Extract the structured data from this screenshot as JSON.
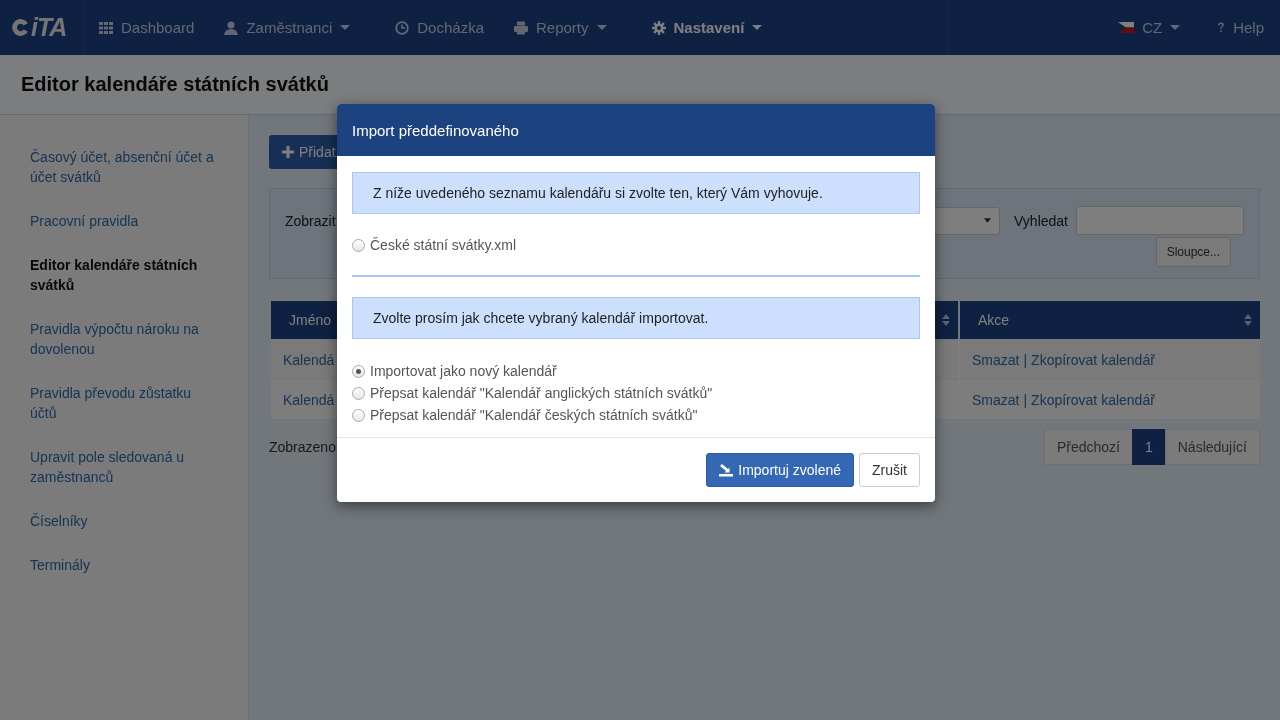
{
  "nav": {
    "logo_text": "iTA",
    "items": [
      {
        "label": "Dashboard",
        "kind": "grid",
        "dropdown": false,
        "selected": false
      },
      {
        "label": "Zaměstnanci",
        "kind": "person",
        "dropdown": true,
        "selected": false
      },
      {
        "label": "Docházka",
        "kind": "clock",
        "dropdown": false,
        "selected": false
      },
      {
        "label": "Reporty",
        "kind": "printer",
        "dropdown": true,
        "selected": false
      },
      {
        "label": "Nastavení",
        "kind": "gear",
        "dropdown": true,
        "selected": true
      }
    ],
    "language": "CZ",
    "help": "Help"
  },
  "page_title": "Editor kalendáře státních svátků",
  "sidebar": {
    "items": [
      {
        "label": "Časový účet, absenční účet a účet svátků",
        "selected": false
      },
      {
        "label": "Pracovní pravidla",
        "selected": false
      },
      {
        "label": "Editor kalendáře státních svátků",
        "selected": true
      },
      {
        "label": "Pravidla výpočtu nároku na dovolenou",
        "selected": false
      },
      {
        "label": "Pravidla převodu zůstatku účtů",
        "selected": false
      },
      {
        "label": "Upravit pole sledovaná u zaměstnanců",
        "selected": false
      },
      {
        "label": "Číselníky",
        "selected": false
      },
      {
        "label": "Terminály",
        "selected": false
      }
    ]
  },
  "add_button": "Přidat",
  "filter": {
    "show_label": "Zobrazit",
    "search_label": "Vyhledat",
    "columns_button": "Sloupce..."
  },
  "table": {
    "columns": [
      "Jméno",
      "Akce"
    ],
    "separator": "|",
    "rows": [
      {
        "name": "Kalendá",
        "actions": [
          "Smazat",
          "Zkopírovat kalendář"
        ]
      },
      {
        "name": "Kalendá",
        "actions": [
          "Smazat",
          "Zkopírovat kalendář"
        ]
      }
    ]
  },
  "footer_text": "Zobrazeno",
  "pagination": [
    {
      "label": "Předchozí",
      "selected": false
    },
    {
      "label": "1",
      "selected": true
    },
    {
      "label": "Následující",
      "selected": false
    }
  ],
  "modal": {
    "title": "Import předdefinovaného",
    "choose_info": "Z níže uvedeného seznamu kalendářu si zvolte ten, který Vám vyhovuje.",
    "calendars": [
      {
        "label": "České státní svátky.xml",
        "selected": false
      }
    ],
    "mode_info": "Zvolte prosím jak chcete vybraný kalendář importovat.",
    "modes": [
      {
        "label": "Importovat jako nový kalendář",
        "selected": true
      },
      {
        "label": "Přepsat kalendář \"Kalendář anglických státních svátků\"",
        "selected": false
      },
      {
        "label": "Přepsat kalendář \"Kalendář českých státních svátků\"",
        "selected": false
      }
    ],
    "import_button": "Importuj zvolené",
    "cancel_button": "Zrušit"
  }
}
